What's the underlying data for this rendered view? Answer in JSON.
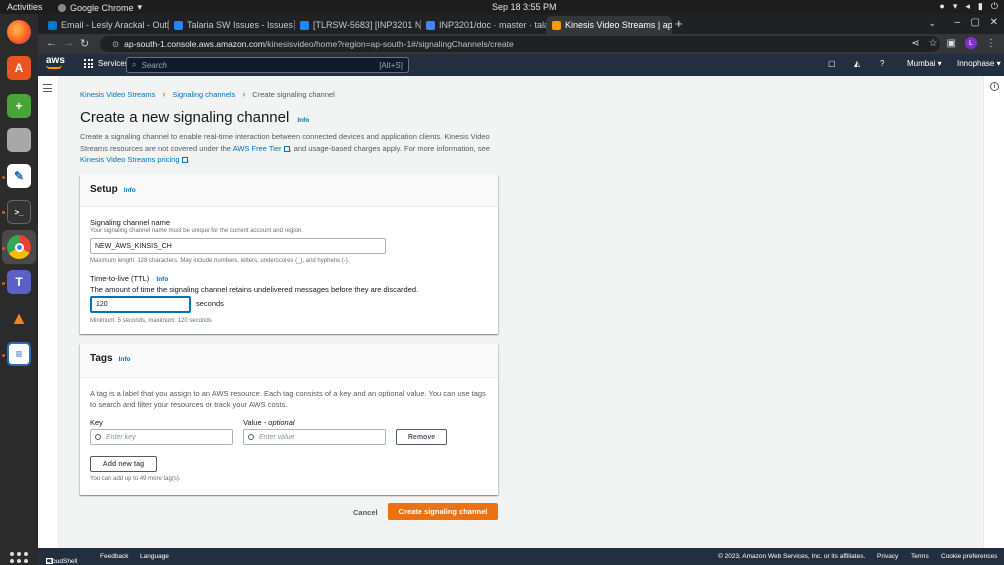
{
  "os": {
    "activities": "Activities",
    "app_name": "Google Chrome",
    "clock": "Sep 18  3:55 PM"
  },
  "browser": {
    "tabs": [
      {
        "label": "Email - Lesly Arackal - Outl",
        "color": "#0078d4"
      },
      {
        "label": "Talaria SW Issues - Issues",
        "color": "#2684ff"
      },
      {
        "label": "[TLRSW-5683] [INP3201 N",
        "color": "#2684ff"
      },
      {
        "label": "INP3201/doc · master · talar",
        "color": "#4285f4"
      },
      {
        "label": "Kinesis Video Streams | ap-",
        "color": "#ff9900"
      }
    ],
    "url_host": "ap-south-1.console.aws.amazon.com",
    "url_path": "/kinesisvideo/home?region=ap-south-1#/signalingChannels/create",
    "profile_initial": "L"
  },
  "aws_nav": {
    "logo": "aws",
    "services": "Services",
    "search_placeholder": "Search",
    "search_shortcut": "[Alt+S]",
    "region": "Mumbai ▾",
    "account": "Innophase ▾"
  },
  "breadcrumb": {
    "items": [
      "Kinesis Video Streams",
      "Signaling channels"
    ],
    "current": "Create signaling channel"
  },
  "page": {
    "title": "Create a new signaling channel",
    "info": "Info",
    "desc_1": "Create a signaling channel to enable real-time interaction between connected devices and application clients. Kinesis Video Streams resources are not covered under the ",
    "desc_link_1": "AWS Free Tier",
    "desc_2": ", and usage-based charges apply. For more information, see ",
    "desc_link_2": "Kinesis Video Streams pricing",
    "desc_3": "."
  },
  "setup": {
    "heading": "Setup",
    "info": "Info",
    "name_label": "Signaling channel name",
    "name_help": "Your signaling channel name must be unique for the current account and region.",
    "name_value": "NEW_AWS_KINSIS_CH",
    "name_constraint": "Maximum length: 128 characters. May include numbers, letters, underscores (_), and hyphens (-).",
    "ttl_label": "Time-to-live (TTL)",
    "ttl_info": "Info",
    "ttl_desc": "The amount of time the signaling channel retains undelivered messages before they are discarded.",
    "ttl_value": "120",
    "ttl_unit": "seconds",
    "ttl_constraint": "Minimum: 5 seconds, maximum: 120 seconds"
  },
  "tags": {
    "heading": "Tags",
    "info": "Info",
    "desc": "A tag is a label that you assign to an AWS resource. Each tag consists of a key and an optional value. You can use tags to search and filter your resources or track your AWS costs.",
    "key_label": "Key",
    "value_label": "Value - ",
    "value_optional": "optional",
    "key_placeholder": "Enter key",
    "value_placeholder": "Enter value",
    "remove": "Remove",
    "add": "Add new tag",
    "limit": "You can add up to 49 more tag(s)."
  },
  "actions": {
    "cancel": "Cancel",
    "create": "Create signaling channel"
  },
  "footer": {
    "cloudshell": "CloudShell",
    "feedback": "Feedback",
    "language": "Language",
    "copyright": "© 2023, Amazon Web Services, Inc. or its affiliates.",
    "privacy": "Privacy",
    "terms": "Terms",
    "cookies": "Cookie preferences"
  },
  "colors": {
    "aws_nav": "#232f3e",
    "link": "#0073bb",
    "primary": "#ec7211"
  }
}
